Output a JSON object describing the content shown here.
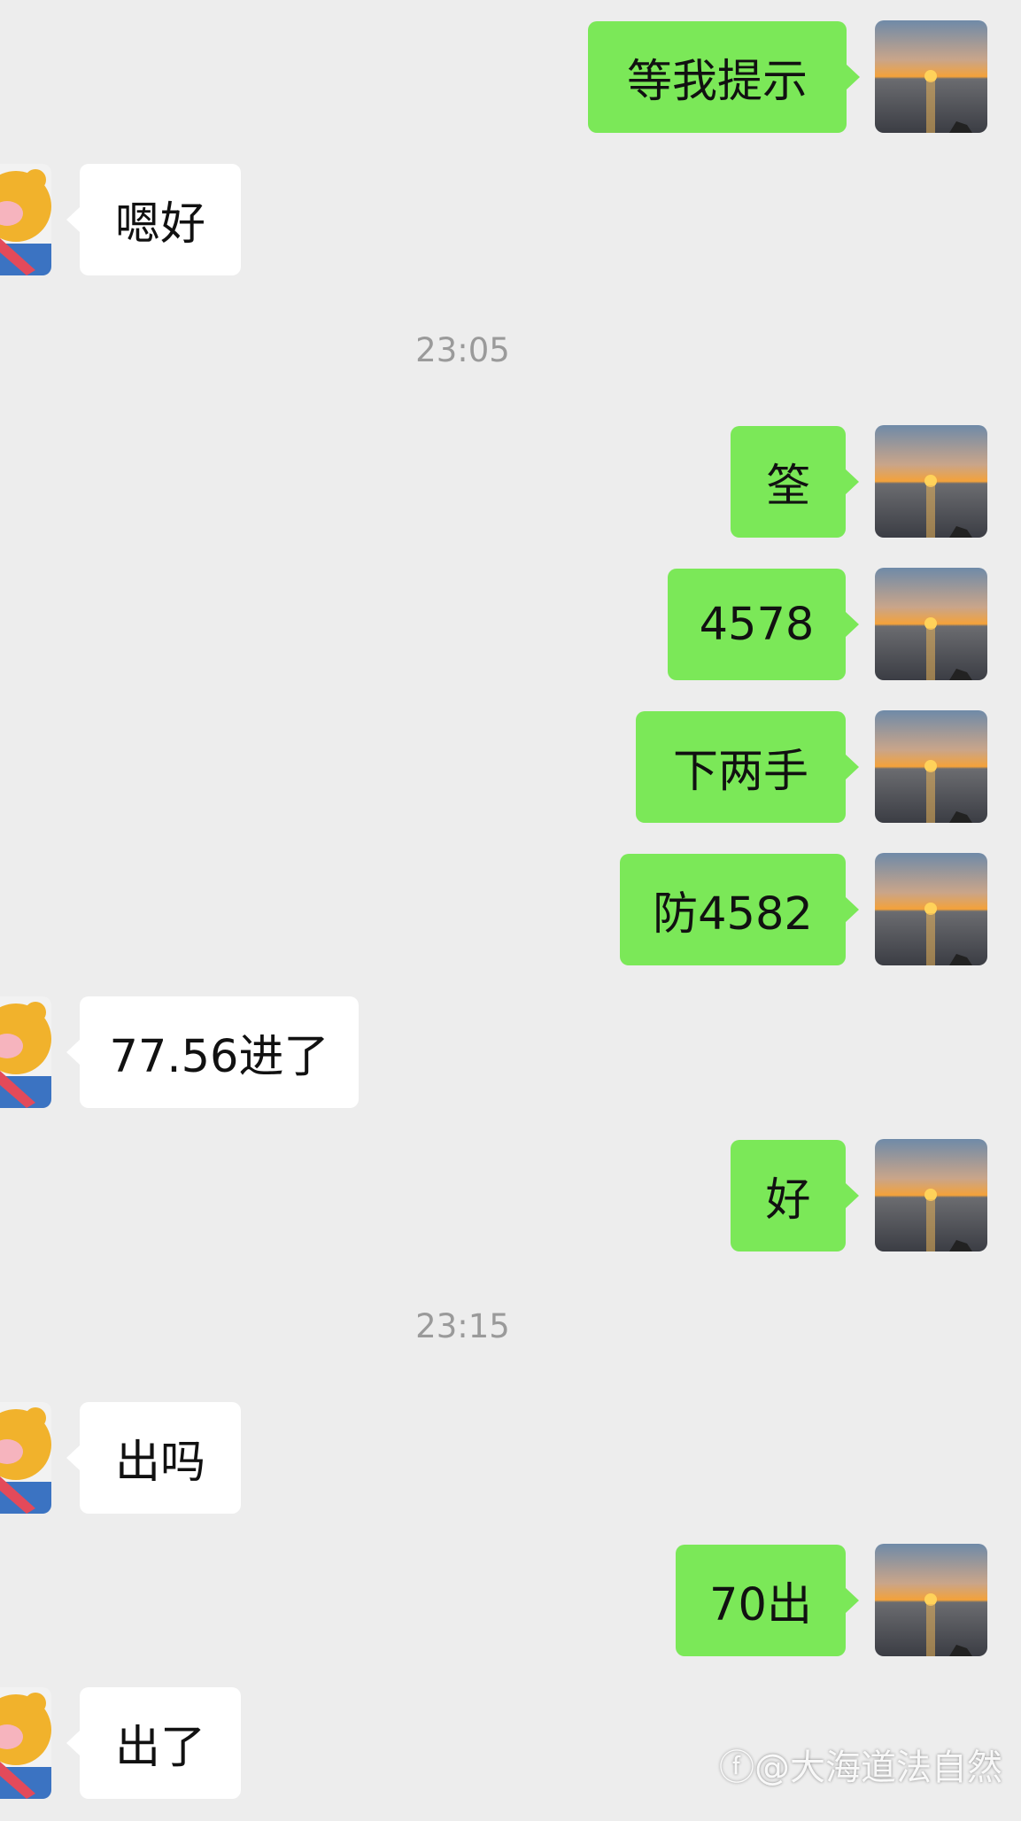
{
  "colors": {
    "background": "#ededed",
    "outgoing_bubble": "#7be858",
    "incoming_bubble": "#ffffff",
    "timestamp_text": "#9a9a9a"
  },
  "icons": {
    "self_avatar": "sunset-over-sea-avatar",
    "contact_avatar": "cartoon-bear-avatar"
  },
  "messages": [
    {
      "side": "out",
      "text": "等我提示"
    },
    {
      "side": "in",
      "text": "嗯好"
    },
    {
      "type": "time",
      "text": "23:05"
    },
    {
      "side": "out",
      "text": "筌"
    },
    {
      "side": "out",
      "text": "4578"
    },
    {
      "side": "out",
      "text": "下两手"
    },
    {
      "side": "out",
      "text": "防4582"
    },
    {
      "side": "in",
      "text": "77.56进了"
    },
    {
      "side": "out",
      "text": "好"
    },
    {
      "type": "time",
      "text": "23:15"
    },
    {
      "side": "in",
      "text": "出吗"
    },
    {
      "side": "out",
      "text": "70出"
    },
    {
      "side": "in",
      "text": "出了"
    }
  ],
  "watermark": "@大海道法自然"
}
